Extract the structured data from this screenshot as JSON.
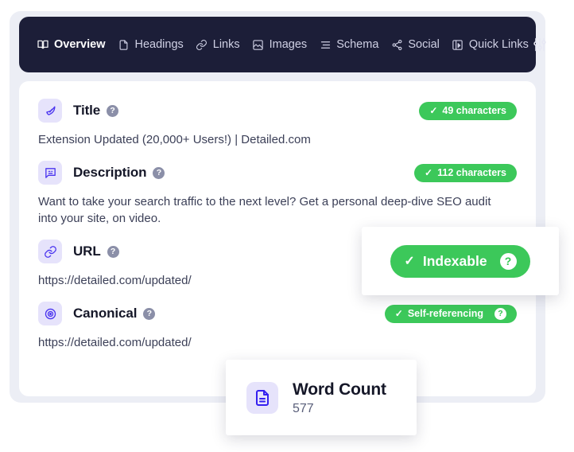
{
  "nav": {
    "items": [
      {
        "label": "Overview",
        "icon": "book-icon",
        "active": true
      },
      {
        "label": "Headings",
        "icon": "document-icon",
        "active": false
      },
      {
        "label": "Links",
        "icon": "link-icon",
        "active": false
      },
      {
        "label": "Images",
        "icon": "image-icon",
        "active": false
      },
      {
        "label": "Schema",
        "icon": "list-icon",
        "active": false
      },
      {
        "label": "Social",
        "icon": "share-icon",
        "active": false
      },
      {
        "label": "Quick Links",
        "icon": "quick-links-icon",
        "active": false
      }
    ],
    "settings_icon": "sliders-icon",
    "background": "#1c1e38"
  },
  "fields": [
    {
      "label": "Title",
      "icon": "rocket-icon",
      "help": "?",
      "badge": {
        "text": "49 characters",
        "tick": "✓",
        "color": "#3cc85a"
      },
      "value": "Extension Updated (20,000+ Users!) | Detailed.com"
    },
    {
      "label": "Description",
      "icon": "speech-bubble-icon",
      "help": "?",
      "badge": {
        "text": "112 characters",
        "tick": "✓",
        "color": "#3cc85a"
      },
      "value": "Want to take your search traffic to the next level? Get a personal deep-dive SEO audit into your site, on video."
    },
    {
      "label": "URL",
      "icon": "link-icon",
      "help": "?",
      "badge": null,
      "value": "https://detailed.com/updated/"
    },
    {
      "label": "Canonical",
      "icon": "target-icon",
      "help": "?",
      "badge": {
        "text": "Self-referencing",
        "tick": "✓",
        "color": "#3cc85a",
        "help": "?"
      },
      "value": "https://detailed.com/updated/"
    }
  ],
  "overlays": {
    "indexable": {
      "tick": "✓",
      "text": "Indexable",
      "help": "?",
      "color": "#3cc85a"
    },
    "word_count": {
      "icon": "document-icon",
      "title": "Word Count",
      "value": "577"
    }
  }
}
